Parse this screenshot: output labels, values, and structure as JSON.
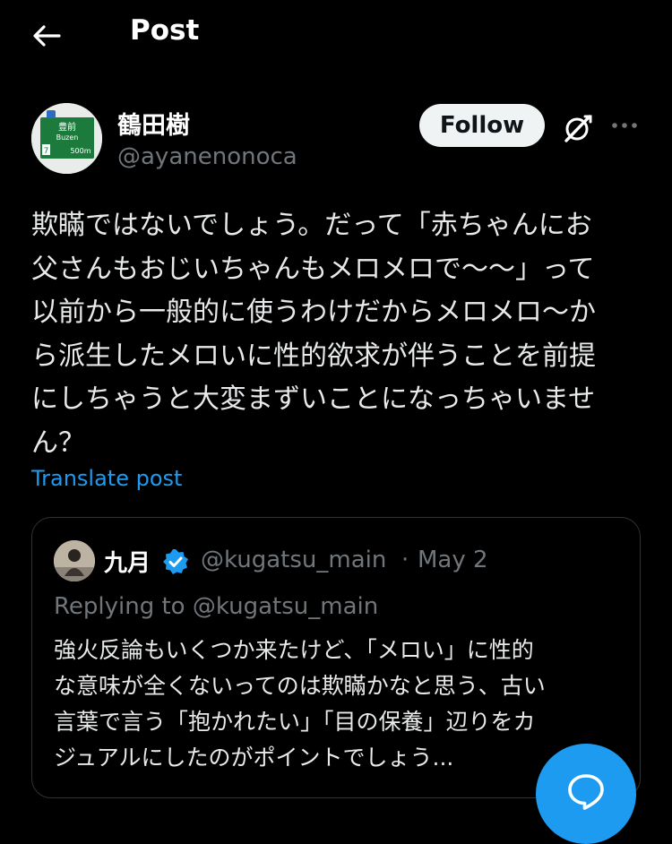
{
  "header": {
    "title": "Post",
    "back_icon": "arrow-left-icon"
  },
  "author": {
    "display_name": "鶴田樹",
    "handle": "@ayanenonoca",
    "avatar_sign_lines": [
      "豊前",
      "Buzen",
      "500m"
    ]
  },
  "actions": {
    "follow_label": "Follow",
    "grok_icon": "grok-icon",
    "more_icon": "more-horizontal-icon"
  },
  "post": {
    "text": "欺瞞ではないでしょう。だって「赤ちゃんにお\n父さんもおじいちゃんもメロメロで〜〜」って\n以前から一般的に使うわけだからメロメロ〜か\nら派生したメロいに性的欲求が伴うことを前提\nにしちゃうと大変まずいことになっちゃいませ\nん？",
    "translate_label": "Translate post"
  },
  "quoted_post": {
    "display_name": "九月",
    "verified_icon": "verified-badge-icon",
    "handle": "@kugatsu_main",
    "separator": "·",
    "date": "May 2",
    "replying_to": "Replying to @kugatsu_main",
    "text": "強火反論もいくつか来たけど、「メロい」に性的\nな意味が全くないってのは欺瞞かなと思う、古い\n言葉で言う「抱かれたい」「目の保養」辺りをカ\nジュアルにしたのがポイントでしょう..."
  },
  "fab": {
    "icon": "reply-bubble-icon"
  },
  "colors": {
    "background": "#000000",
    "accent": "#1d9bf0",
    "secondary_text": "#71767b",
    "border": "#2f3336"
  }
}
